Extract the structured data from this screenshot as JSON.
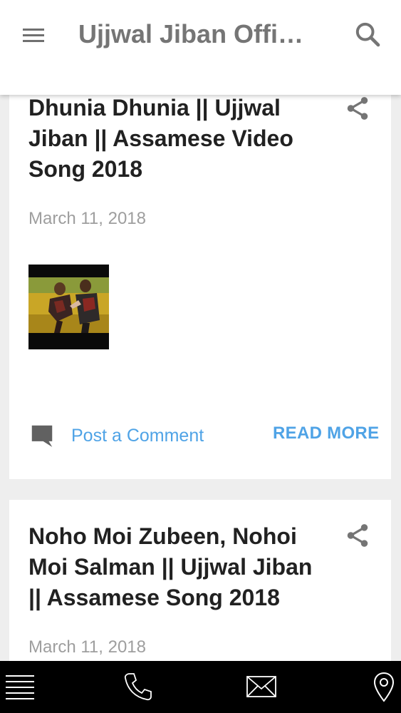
{
  "header": {
    "title": "Ujjwal Jiban Offi…",
    "menu_icon": "hamburger-menu-icon",
    "search_icon": "search-icon"
  },
  "posts": [
    {
      "title": "Dhunia Dhunia || Ujjwal Jiban || Assamese Video Song 2018",
      "date": "March 11, 2018",
      "comment_label": "Post a Comment",
      "read_more_label": "READ MORE",
      "share_icon": "share-icon",
      "comment_icon": "comment-icon"
    },
    {
      "title": "Noho Moi Zubeen, Nohoi Moi Salman || Ujjwal Jiban || Assamese Song 2018",
      "date": "March 11, 2018",
      "share_icon": "share-icon"
    }
  ],
  "bottom_nav": {
    "items": [
      "menu-icon",
      "phone-icon",
      "mail-icon",
      "location-pin-icon"
    ]
  },
  "colors": {
    "accent": "#4fa3e6",
    "title_text": "#212121",
    "muted_text": "#9e9e9e",
    "header_title": "#757575",
    "background": "#eeeeee",
    "bottom_bar": "#000000"
  }
}
